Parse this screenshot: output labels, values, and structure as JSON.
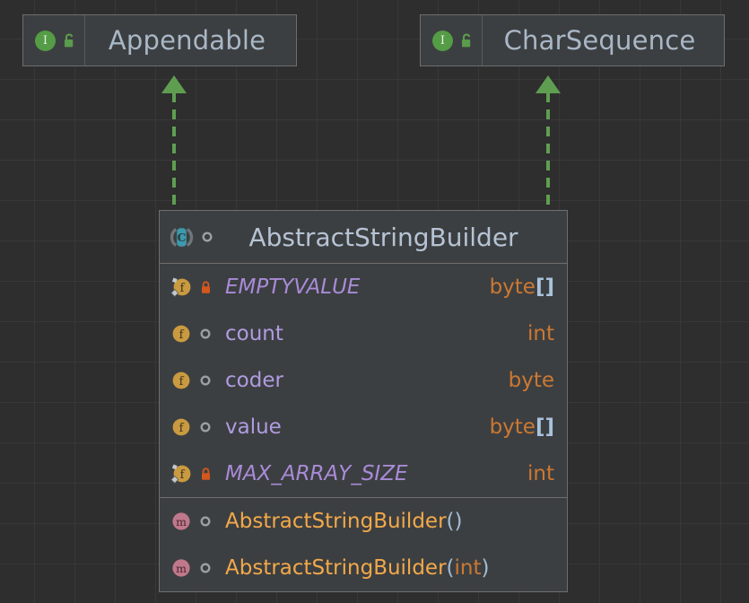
{
  "diagram": {
    "title": "AbstractStringBuilder UML class diagram",
    "background_color": "#2e2e2e",
    "grid_color": "#383838",
    "relation_color": "#5f9e51",
    "relation_type": "realization"
  },
  "interfaces": [
    {
      "name": "Appendable",
      "icon": "interface-icon",
      "visibility": "public",
      "visibility_icon": "unlocked-padlock-icon"
    },
    {
      "name": "CharSequence",
      "icon": "interface-icon",
      "visibility": "public",
      "visibility_icon": "unlocked-padlock-icon"
    }
  ],
  "class": {
    "name": "AbstractStringBuilder",
    "icon": "abstract-class-icon",
    "visibility_icon": "package-private-circle-icon",
    "fields": [
      {
        "name": "EMPTYVALUE",
        "type": "byte",
        "array": "[]",
        "icon": "static-field-icon",
        "visibility_icon": "locked-padlock-icon",
        "static": true,
        "italic": true
      },
      {
        "name": "count",
        "type": "int",
        "array": "",
        "icon": "field-icon",
        "visibility_icon": "package-private-circle-icon",
        "static": false,
        "italic": false
      },
      {
        "name": "coder",
        "type": "byte",
        "array": "",
        "icon": "field-icon",
        "visibility_icon": "package-private-circle-icon",
        "static": false,
        "italic": false
      },
      {
        "name": "value",
        "type": "byte",
        "array": "[]",
        "icon": "field-icon",
        "visibility_icon": "package-private-circle-icon",
        "static": false,
        "italic": false
      },
      {
        "name": "MAX_ARRAY_SIZE",
        "type": "int",
        "array": "",
        "icon": "static-field-icon",
        "visibility_icon": "locked-padlock-icon",
        "static": true,
        "italic": true
      }
    ],
    "methods": [
      {
        "name": "AbstractStringBuilder",
        "open_paren": "(",
        "params": "",
        "close_paren": ")",
        "icon": "method-icon",
        "visibility_icon": "package-private-circle-icon"
      },
      {
        "name": "AbstractStringBuilder",
        "open_paren": "(",
        "params": "int",
        "close_paren": ")",
        "icon": "method-icon",
        "visibility_icon": "package-private-circle-icon"
      }
    ]
  },
  "colors": {
    "node_fill": "#3c3f41",
    "node_border": "#6e6e6e",
    "interface_icon": "#549c45",
    "class_icon": "#3d9aad",
    "field_icon": "#c99a3f",
    "method_icon": "#c0788b",
    "lock_private": "#d4571e",
    "type_text": "#cc7832",
    "field_name_text": "#b09be0",
    "method_name_text": "#f3a94a",
    "title_text": "#a9b7c6"
  }
}
